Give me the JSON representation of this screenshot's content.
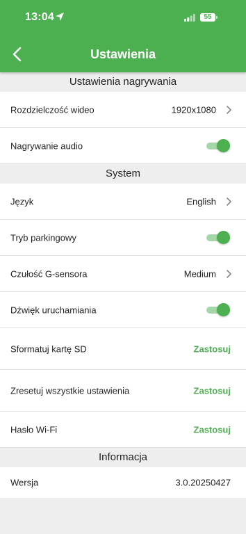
{
  "status_bar": {
    "time": "13:04",
    "battery": "55",
    "location_icon": "location-arrow-icon",
    "signal_icon": "cellular-signal-icon"
  },
  "header": {
    "title": "Ustawienia",
    "back_icon": "chevron-left-icon"
  },
  "sections": {
    "recording": {
      "title": "Ustawienia nagrywania",
      "video_resolution": {
        "label": "Rozdzielczość wideo",
        "value": "1920x1080"
      },
      "audio_recording": {
        "label": "Nagrywanie audio",
        "enabled": true
      }
    },
    "system": {
      "title": "System",
      "language": {
        "label": "Język",
        "value": "English"
      },
      "parking_mode": {
        "label": "Tryb parkingowy",
        "enabled": true
      },
      "g_sensor": {
        "label": "Czułość G-sensora",
        "value": "Medium"
      },
      "startup_sound": {
        "label": "Dźwięk uruchamiania",
        "enabled": true
      },
      "format_sd": {
        "label": "Sformatuj kartę SD",
        "action": "Zastosuj"
      },
      "reset_all": {
        "label": "Zresetuj wszystkie ustawienia",
        "action": "Zastosuj"
      },
      "wifi_password": {
        "label": "Hasło Wi-Fi",
        "action": "Zastosuj"
      }
    },
    "info": {
      "title": "Informacja",
      "version": {
        "label": "Wersja",
        "value": "3.0.20250427"
      }
    }
  },
  "colors": {
    "accent": "#4caf50",
    "toggle_track": "#a5d6a7",
    "background": "#eeeeef"
  }
}
